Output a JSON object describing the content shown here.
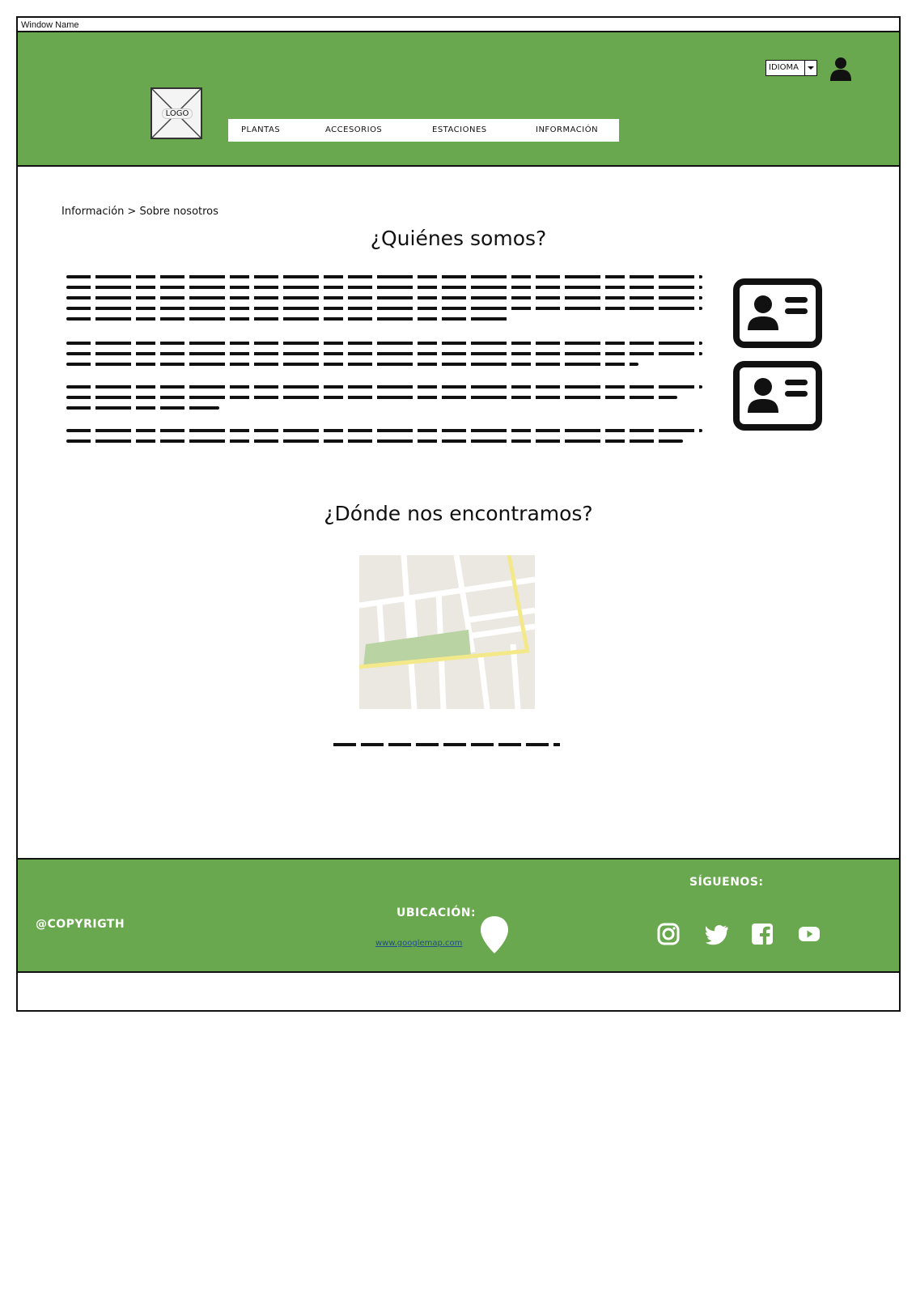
{
  "window": {
    "title": "Window Name"
  },
  "header": {
    "logo_label": "LOGO",
    "nav": [
      {
        "label": "PLANTAS"
      },
      {
        "label": "ACCESORIOS"
      },
      {
        "label": "ESTACIONES"
      },
      {
        "label": "INFORMACIÓN"
      }
    ],
    "language_select": {
      "label": "IDIOMA"
    },
    "icons": {
      "user": "user-icon",
      "language_dropdown": "chevron-down-icon"
    }
  },
  "main": {
    "breadcrumb": "Información > Sobre nosotros",
    "about_heading": "¿Quiénes somos?",
    "contact_cards": [
      {
        "icon": "contact-card-icon"
      },
      {
        "icon": "contact-card-icon"
      }
    ],
    "location_heading": "¿Dónde nos encontramos?",
    "map": {
      "icon": "map-image"
    }
  },
  "footer": {
    "copyright": "@COPYRIGTH",
    "location_title": "UBICACIÓN:",
    "location_link": "www.googlemap.com",
    "location_icon": "map-pin-icon",
    "follow_title": "SÍGUENOS:",
    "social": [
      {
        "icon": "instagram-icon"
      },
      {
        "icon": "twitter-icon"
      },
      {
        "icon": "facebook-icon"
      },
      {
        "icon": "youtube-icon"
      }
    ]
  },
  "colors": {
    "brand_green": "#6aa84f",
    "link": "#1f4e8c"
  }
}
